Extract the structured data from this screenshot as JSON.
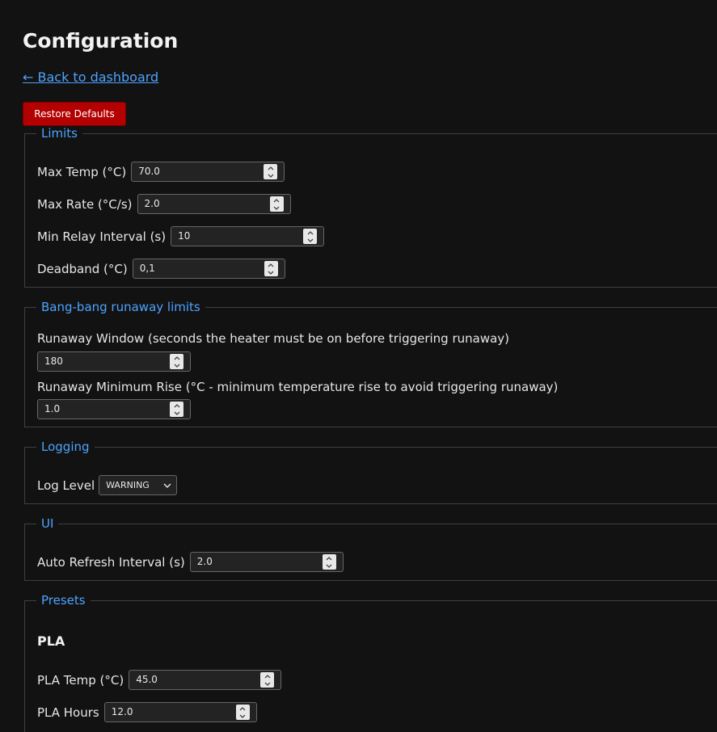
{
  "page": {
    "title": "Configuration",
    "back_link": "← Back to dashboard",
    "restore_label": "Restore Defaults"
  },
  "limits": {
    "legend": "Limits",
    "max_temp": {
      "label": "Max Temp (°C)",
      "value": "70.0"
    },
    "max_rate": {
      "label": "Max Rate (°C/s)",
      "value": "2.0"
    },
    "min_relay": {
      "label": "Min Relay Interval (s)",
      "value": "10"
    },
    "deadband": {
      "label": "Deadband (°C)",
      "value": "0,1"
    }
  },
  "runaway": {
    "legend": "Bang-bang runaway limits",
    "window": {
      "label": "Runaway Window (seconds the heater must be on before triggering runaway)",
      "value": "180"
    },
    "min_rise": {
      "label": "Runaway Minimum Rise (°C - minimum temperature rise to avoid triggering runaway)",
      "value": "1.0"
    }
  },
  "logging": {
    "legend": "Logging",
    "log_level": {
      "label": "Log Level",
      "value": "WARNING"
    }
  },
  "ui": {
    "legend": "UI",
    "refresh": {
      "label": "Auto Refresh Interval (s)",
      "value": "2.0"
    }
  },
  "presets": {
    "legend": "Presets",
    "pla": {
      "title": "PLA",
      "temp": {
        "label": "PLA Temp (°C)",
        "value": "45.0"
      },
      "hours": {
        "label": "PLA Hours",
        "value": "12.0"
      }
    }
  },
  "colors": {
    "accent": "#4da3ff",
    "danger": "#b30000",
    "background": "#121212"
  }
}
